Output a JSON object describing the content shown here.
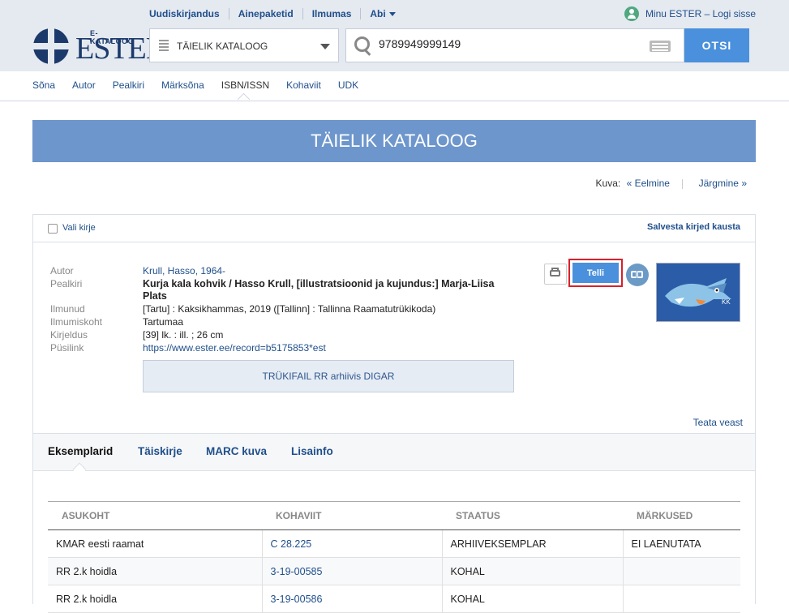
{
  "logo": {
    "small": "E-KATALOOG",
    "big": "ESTER"
  },
  "topnav": [
    "Uudiskirjandus",
    "Ainepaketid",
    "Ilmumas",
    "Abi"
  ],
  "user": "Minu ESTER – Logi sisse",
  "catalog_select": "TÄIELIK KATALOOG",
  "search": {
    "value": "9789949999149",
    "button": "OTSI"
  },
  "subnav": [
    "Sõna",
    "Autor",
    "Pealkiri",
    "Märksõna",
    "ISBN/ISSN",
    "Kohaviit",
    "UDK"
  ],
  "banner": "TÄIELIK KATALOOG",
  "kuva": {
    "label": "Kuva:",
    "prev": "« Eelmine",
    "next": "Järgmine »"
  },
  "record": {
    "select_label": "Vali kirje",
    "save_label": "Salvesta kirjed kausta",
    "fields": [
      {
        "k": "Autor",
        "v": "Krull, Hasso, 1964-"
      },
      {
        "k": "Pealkiri",
        "v": "Kurja kala kohvik / Hasso Krull, [illustratsioonid ja kujundus:] Marja-Liisa Plats"
      },
      {
        "k": "Ilmunud",
        "v": "[Tartu] : Kaksikhammas, 2019 ([Tallinn] : Tallinna Raamatutrükikoda)"
      },
      {
        "k": "Ilmumiskoht",
        "v": "Tartumaa"
      },
      {
        "k": "Kirjeldus",
        "v": "[39] lk. : ill. ; 26 cm"
      },
      {
        "k": "Püsilink",
        "v": "https://www.ester.ee/record=b5175853*est"
      }
    ],
    "digar": "TRÜKIFAIL RR arhiivis DIGAR",
    "order_button": "Telli",
    "report": "Teata veast"
  },
  "tabs": [
    "Eksemplarid",
    "Täiskirje",
    "MARC kuva",
    "Lisainfo"
  ],
  "table": {
    "headers": [
      "ASUKOHT",
      "KOHAVIIT",
      "STAATUS",
      "MÄRKUSED"
    ],
    "rows": [
      [
        "KMAR eesti raamat",
        "C 28.225",
        "ARHIIVEKSEMPLAR",
        "EI LAENUTATA"
      ],
      [
        "RR 2.k hoidla",
        "3-19-00585",
        "KOHAL",
        ""
      ],
      [
        "RR 2.k hoidla",
        "3-19-00586",
        "KOHAL",
        ""
      ]
    ]
  },
  "colors": {
    "accent": "#4a90dc",
    "banner": "#6d96cc",
    "link": "#1f4f8b",
    "highlight": "#d9202a"
  }
}
